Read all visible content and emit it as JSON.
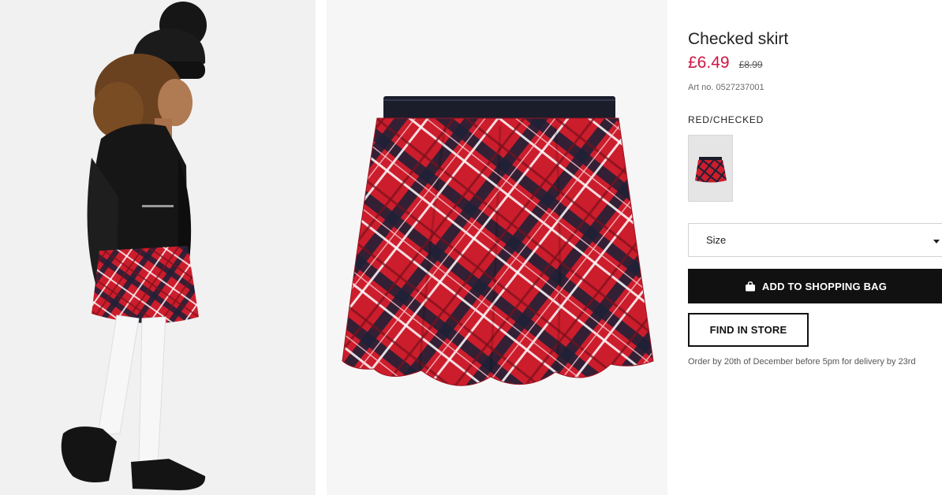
{
  "product": {
    "title": "Checked skirt",
    "price_current": "£6.49",
    "price_original": "£8.99",
    "article_number": "Art no. 0527237001",
    "color_name": "RED/CHECKED",
    "images": [
      {
        "semantic": "model-photo"
      },
      {
        "semantic": "product-photo"
      }
    ]
  },
  "size_select": {
    "label": "Size",
    "icon": "chevron-down-icon"
  },
  "buttons": {
    "add_to_bag": "ADD TO SHOPPING BAG",
    "add_to_bag_icon": "shopping-bag-icon",
    "find_in_store": "FIND IN STORE"
  },
  "delivery_note": "Order by 20th of December before 5pm for delivery by 23rd",
  "colors": {
    "price_red": "#d01345",
    "button_black": "#111111",
    "tartan_red": "#cc1d2c",
    "tartan_navy": "#1d2036"
  }
}
